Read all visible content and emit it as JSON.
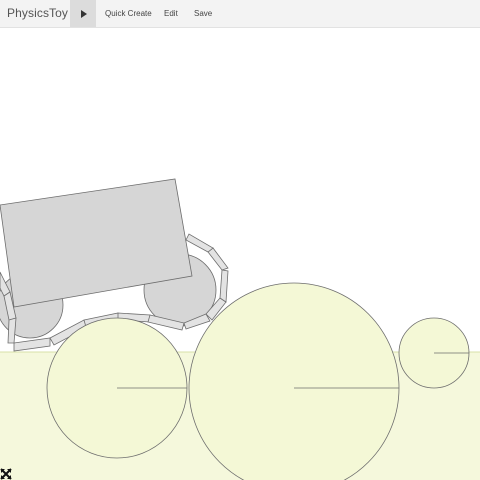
{
  "app": {
    "title": "PhysicsToy"
  },
  "toolbar": {
    "play_icon": "play-icon",
    "items": [
      {
        "label": "Quick Create"
      },
      {
        "label": "Edit"
      },
      {
        "label": "Save"
      }
    ]
  },
  "scene": {
    "ground_color": "#f5f8dc",
    "ground_edge_color": "#d8e0a8",
    "ball_fill": "#f4f8d6",
    "body_fill": "#d6d6d6",
    "outline_color": "#6d6d6d",
    "objects": [
      "chassis-box",
      "left-wheel",
      "right-wheel",
      "tread",
      "ball-left",
      "ball-center",
      "ball-right"
    ]
  },
  "corner_icon": "resize-arrows-icon"
}
